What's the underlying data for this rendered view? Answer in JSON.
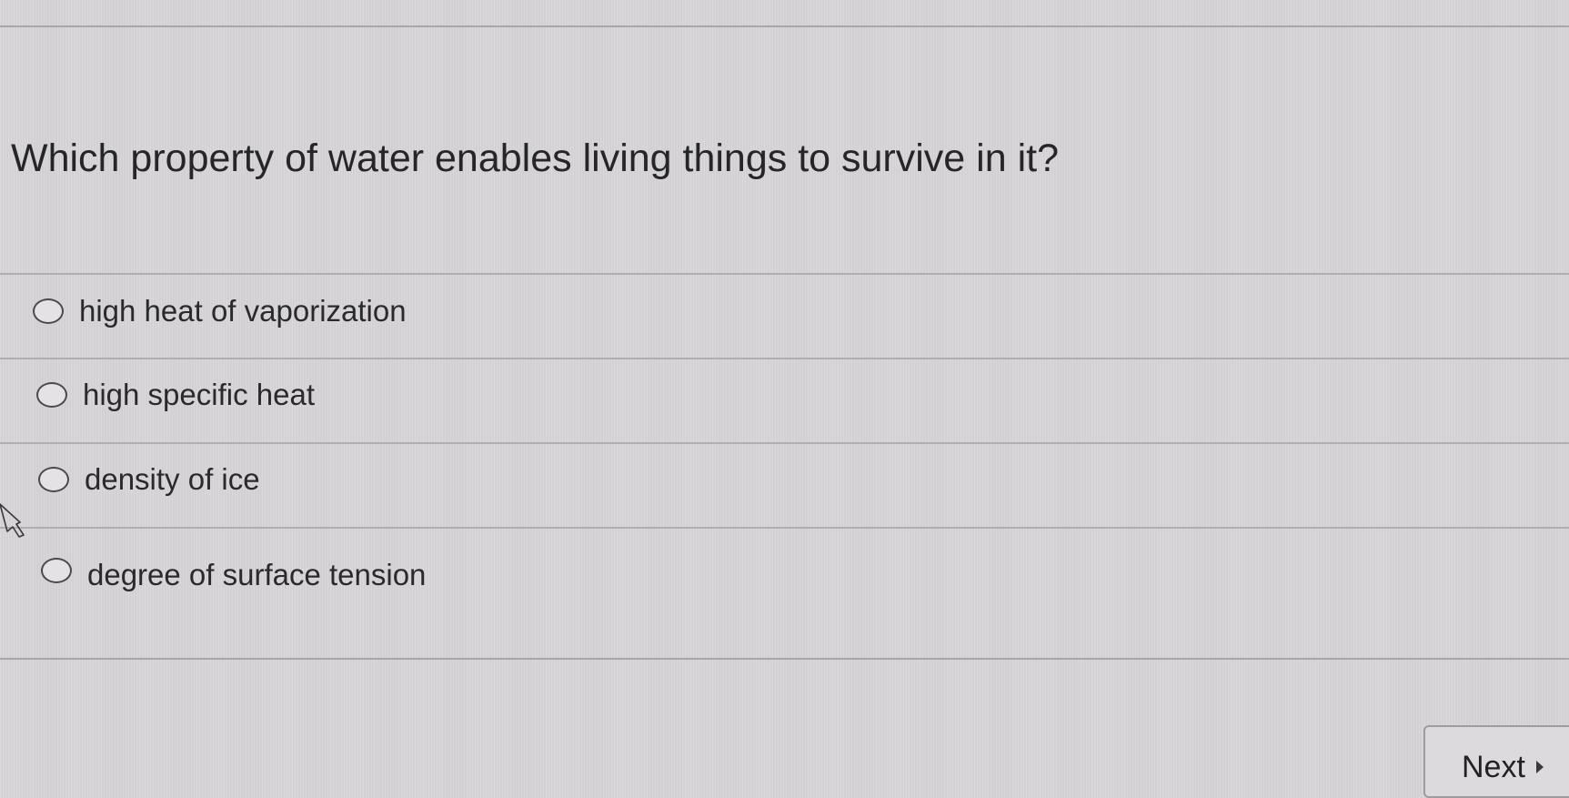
{
  "question": {
    "text": "Which property of water enables living things to survive in it?"
  },
  "options": [
    {
      "label": "high heat of vaporization",
      "selected": false
    },
    {
      "label": "high specific heat",
      "selected": false
    },
    {
      "label": "density of ice",
      "selected": false
    },
    {
      "label": "degree of surface tension",
      "selected": false
    }
  ],
  "nav": {
    "next_label": "Next",
    "next_icon": "caret-right-icon"
  },
  "cursor": {
    "icon": "mouse-pointer-icon"
  },
  "colors": {
    "background": "#d7d5d8",
    "text": "#2b2a2d",
    "divider": "#a8a6a9"
  }
}
